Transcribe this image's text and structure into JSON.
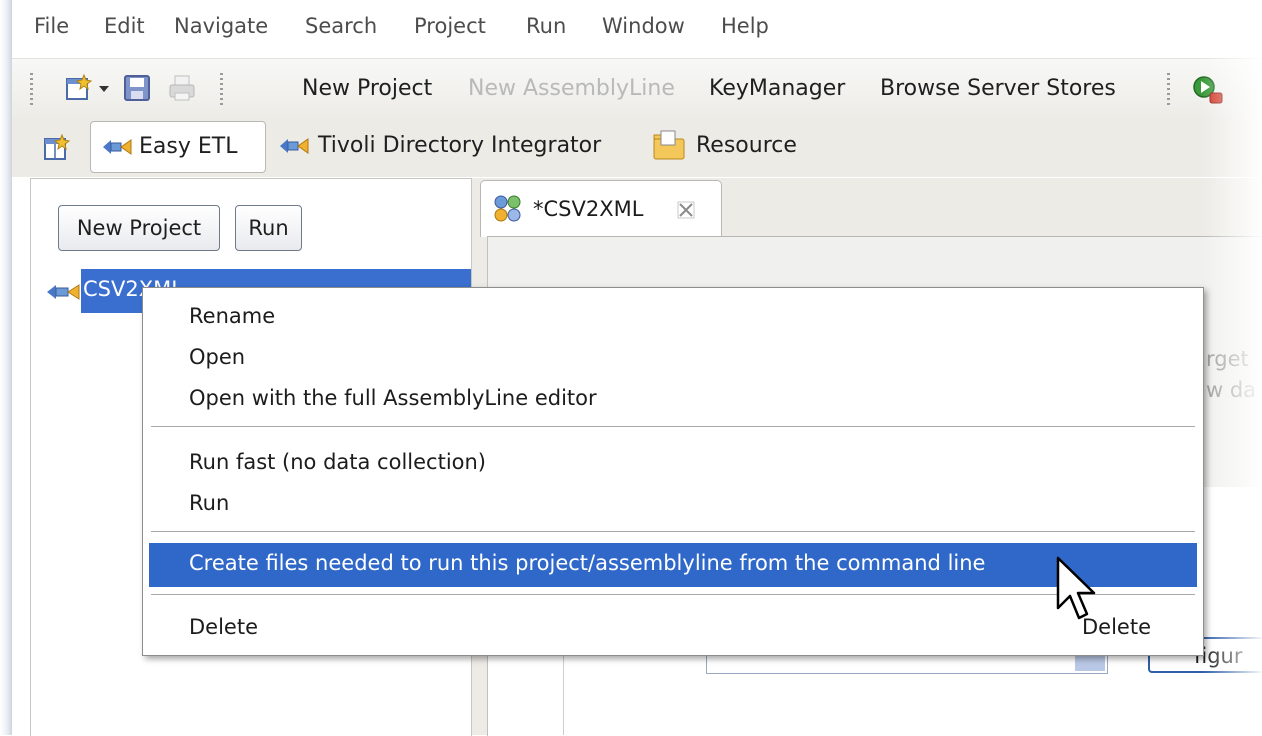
{
  "menubar": {
    "items": [
      "File",
      "Edit",
      "Navigate",
      "Search",
      "Project",
      "Run",
      "Window",
      "Help"
    ]
  },
  "toolbar": {
    "new_project": "New Project",
    "new_assemblyline": "New AssemblyLine",
    "key_manager": "KeyManager",
    "browse_server_stores": "Browse Server Stores"
  },
  "perspectives": {
    "easy_etl": "Easy ETL",
    "tdi": "Tivoli Directory Integrator",
    "resource": "Resource"
  },
  "left_panel": {
    "new_project_button": "New Project",
    "run_button": "Run",
    "tree_item": "CSV2XML"
  },
  "editor": {
    "tab_label": "*CSV2XML",
    "peek_1": "rget",
    "peek_2": "w da",
    "peek_3": "figur"
  },
  "context_menu": {
    "rename": "Rename",
    "open": "Open",
    "open_full": "Open with the full AssemblyLine editor",
    "run_fast": "Run fast (no data collection)",
    "run": "Run",
    "create_files": "Create files needed to run this project/assemblyline from the command line",
    "delete": "Delete",
    "delete_accel": "Delete"
  },
  "colors": {
    "selection": "#2f68c8",
    "toolbar_bg": "#ecebe6"
  }
}
